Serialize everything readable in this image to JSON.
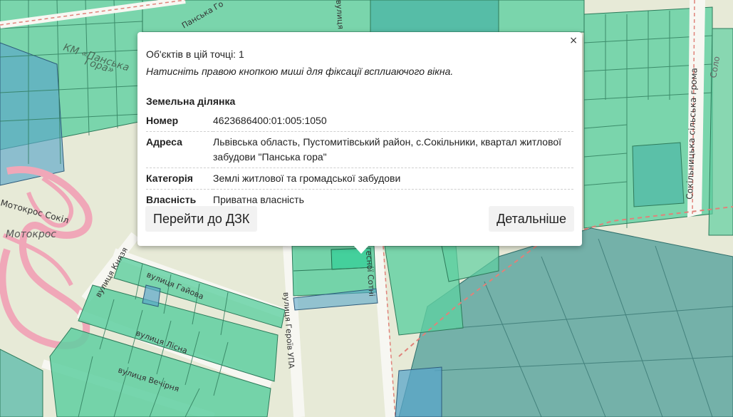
{
  "map": {
    "colors": {
      "background": "#e7ead7",
      "parcel_green": "#5fcfa1",
      "parcel_teal": "#4eb7a6",
      "parcel_blue": "#5aa6c9",
      "parcel_dark": "#4e9e99",
      "road": "#f7f7f2",
      "border_dash": "#e0827a",
      "motocross_track": "#f0a7b8"
    },
    "labels": {
      "km_panska": "КМ «Панська",
      "gora": "Гора»",
      "motokros_sokil": "Мотокрос Сокіл",
      "motokros": "Мотокрос",
      "street_kniazia": "вулиця Князя",
      "street_haiova": "вулиця Гайова",
      "street_lisna": "вулиця Лісна",
      "street_vechirnia": "вулиця Вечірня",
      "street_heroiv_upa": "вулиця Героїв УПА",
      "street_sotni": "есної Сотні",
      "street_top": "вулиця",
      "street_panska": "Панська Го",
      "sokilnytska": "Сокільницька сільська грома",
      "solo": "Соло"
    }
  },
  "popup": {
    "objects_count": "Об'єктів в цій точці: 1",
    "hint": "Натисніть правою кнопкою миші для фіксації всплиаючого вікна.",
    "close": "×",
    "section_title": "Земельна ділянка",
    "rows": [
      {
        "key": "Номер",
        "value": "4623686400:01:005:1050"
      },
      {
        "key": "Адреса",
        "value": "Львівська область, Пустомитівський район, с.Сокільники, квартал житлової забудови \"Панська гора\""
      },
      {
        "key": "Категорія",
        "value": "Землі житлової та громадської забудови"
      },
      {
        "key": "Власність",
        "value": "Приватна власність"
      }
    ],
    "buttons": {
      "dzk": "Перейти до ДЗК",
      "more": "Детальніше"
    }
  }
}
